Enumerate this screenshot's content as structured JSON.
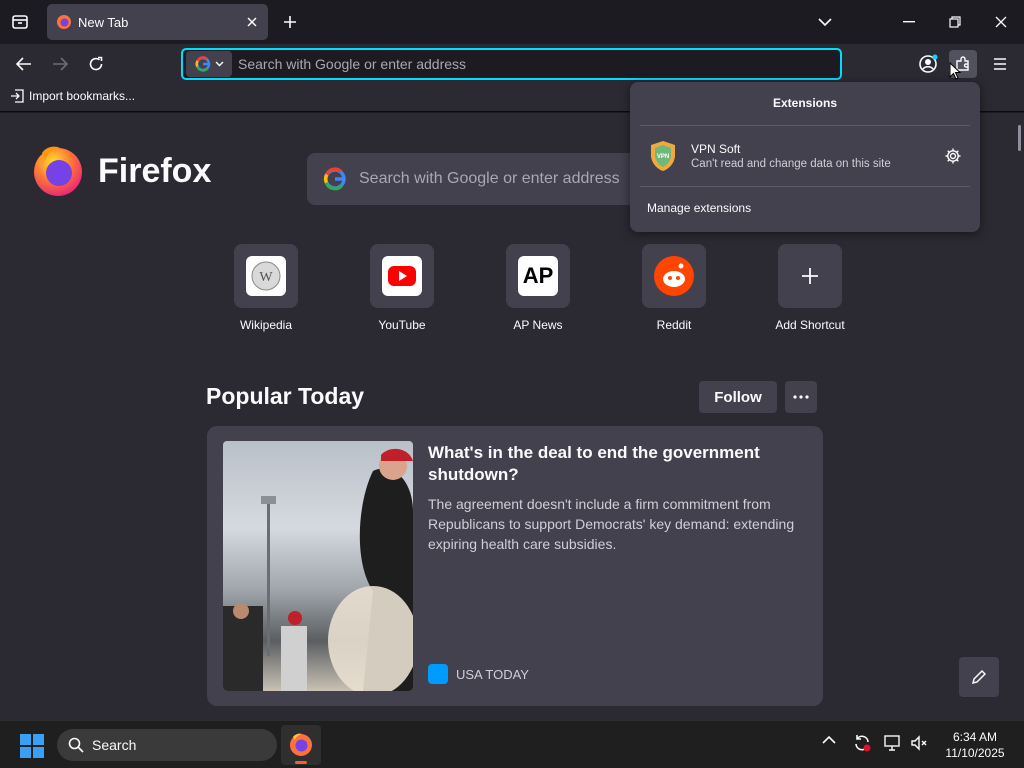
{
  "tab": {
    "title": "New Tab"
  },
  "urlbar": {
    "placeholder": "Search with Google or enter address"
  },
  "bookmarks": {
    "import_label": "Import bookmarks..."
  },
  "newtab": {
    "brand": "Firefox",
    "search_placeholder": "Search with Google or enter address",
    "shortcuts": [
      {
        "label": "Wikipedia"
      },
      {
        "label": "YouTube"
      },
      {
        "label": "AP News",
        "tile_text": "AP"
      },
      {
        "label": "Reddit"
      },
      {
        "label": "Add Shortcut"
      }
    ],
    "popular": {
      "heading": "Popular Today",
      "follow_label": "Follow",
      "story": {
        "headline": "What's in the deal to end the government shutdown?",
        "excerpt": "The agreement doesn't include a firm commitment from Republicans to support Democrats' key demand: extending expiring health care subsidies.",
        "source": "USA TODAY"
      }
    }
  },
  "extensions_panel": {
    "title": "Extensions",
    "items": [
      {
        "name": "VPN Soft",
        "status": "Can't read and change data on this site",
        "badge": "VPN"
      }
    ],
    "manage_label": "Manage extensions"
  },
  "taskbar": {
    "search_label": "Search",
    "time": "6:34 AM",
    "date": "11/10/2025"
  },
  "colors": {
    "accent": "#00ddff",
    "tab_bg": "#42414d",
    "content_bg": "#2b2a33"
  }
}
